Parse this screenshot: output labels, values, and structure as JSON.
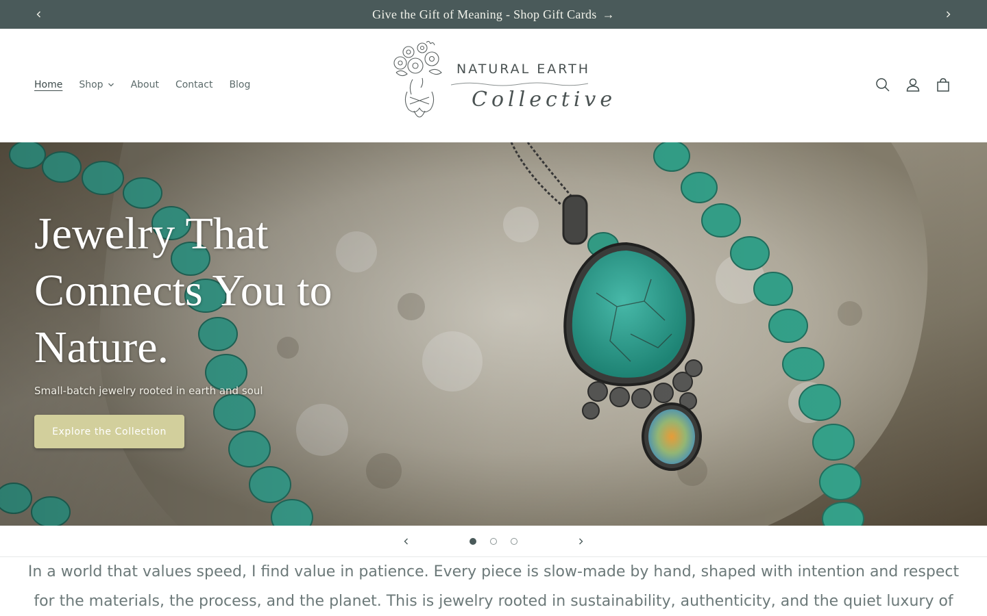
{
  "announcement": {
    "text": "Give the Gift of Meaning - Shop Gift Cards",
    "arrow": "→"
  },
  "nav": {
    "items": [
      {
        "label": "Home"
      },
      {
        "label": "Shop"
      },
      {
        "label": "About"
      },
      {
        "label": "Contact"
      },
      {
        "label": "Blog"
      }
    ]
  },
  "logo": {
    "line1": "NATURAL EARTH",
    "line2": "Collective"
  },
  "header_icons": [
    "search-icon",
    "account-icon",
    "cart-icon"
  ],
  "hero": {
    "title": "Jewelry That Connects You to Nature.",
    "subtitle": "Small-batch jewelry rooted in earth and soul",
    "cta": "Explore the Collection",
    "slide_count": 3,
    "active_slide": 1
  },
  "intro": {
    "text": "In a world that values speed, I find value in patience. Every piece is slow-made by hand, shaped with intention and respect for the materials, the process, and the planet. This is jewelry rooted in sustainability, authenticity, and the quiet luxury of things"
  },
  "colors": {
    "announcement_bg": "#4a5a5a",
    "cta_bg": "#d2cf9c",
    "turquoise": "#3fb3a3"
  }
}
